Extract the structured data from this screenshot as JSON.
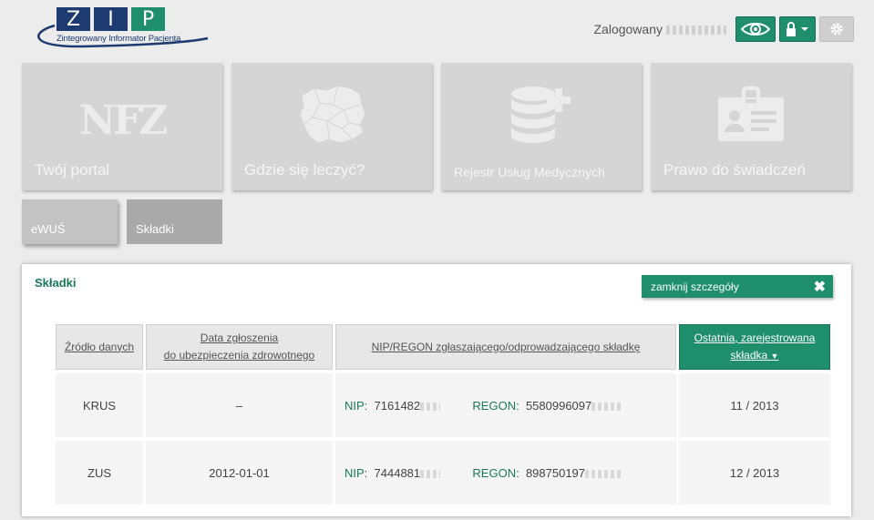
{
  "app": {
    "logo_letters": [
      "Z",
      "I",
      "P"
    ],
    "logo_tagline": "Zintegrowany Informator Pacjenta"
  },
  "header": {
    "logged_in_label": "Zalogowany",
    "eye_icon": "eye-icon",
    "lock_icon": "lock-icon",
    "gear_icon": "gear-icon"
  },
  "tiles": [
    {
      "label": "Twój portal",
      "icon": "nfz-logo",
      "logo_text": "NFZ"
    },
    {
      "label": "Gdzie się leczyć?",
      "icon": "poland-map-icon"
    },
    {
      "label": "Rejestr Usług Medycznych",
      "icon": "database-plus-icon"
    },
    {
      "label": "Prawo do świadczeń",
      "icon": "id-card-icon"
    }
  ],
  "sub_tiles": [
    {
      "label": "eWUŚ"
    },
    {
      "label": "Składki"
    }
  ],
  "panel": {
    "title": "Składki",
    "close_label": "zamknij szczegóły",
    "columns": [
      "Źródło danych",
      "Data zgłoszenia do ubezpieczenia zdrowotnego",
      "NIP/REGON zgłaszającego/odprowadzającego składkę",
      "Ostatnia, zarejestrowana składka"
    ],
    "col2_line1": "Data zgłoszenia",
    "col2_line2": "do ubezpieczenia zdrowotnego",
    "col4_line1": "Ostatnia, zarejestrowana",
    "col4_line2": "składka",
    "nip_label": "NIP:",
    "regon_label": "REGON:",
    "rows": [
      {
        "source": "KRUS",
        "date": "–",
        "nip": "7161482",
        "regon": "5580996097",
        "last": "11 / 2013"
      },
      {
        "source": "ZUS",
        "date": "2012-01-01",
        "nip": "7444881",
        "regon": "898750197",
        "last": "12 / 2013"
      }
    ]
  },
  "colors": {
    "accent": "#1e8f6a",
    "brand_navy": "#1d3b70",
    "tile_bg": "#d5d5d5"
  }
}
